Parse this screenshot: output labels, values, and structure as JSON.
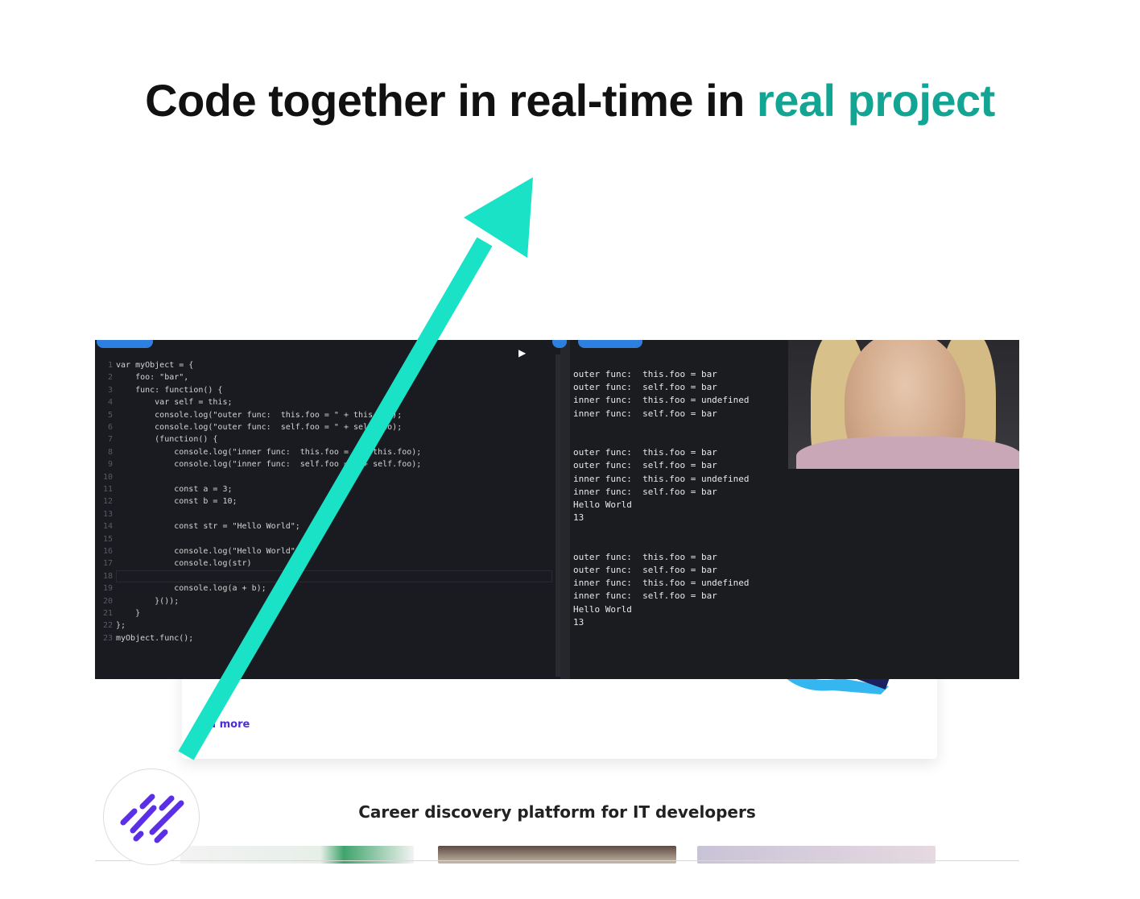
{
  "headline": {
    "text": "Code together in real-time in",
    "accent": "real project"
  },
  "colors": {
    "accent_text": "#12a593",
    "arrow": "#19e2c6",
    "logo": "#5b2ee8",
    "link": "#4a2fd6"
  },
  "editor": {
    "lines": [
      {
        "n": "1",
        "code": "var myObject = {"
      },
      {
        "n": "2",
        "code": "    foo: \"bar\","
      },
      {
        "n": "3",
        "code": "    func: function() {"
      },
      {
        "n": "4",
        "code": "        var self = this;"
      },
      {
        "n": "5",
        "code": "        console.log(\"outer func:  this.foo = \" + this.foo);"
      },
      {
        "n": "6",
        "code": "        console.log(\"outer func:  self.foo = \" + self.foo);"
      },
      {
        "n": "7",
        "code": "        (function() {"
      },
      {
        "n": "8",
        "code": "            console.log(\"inner func:  this.foo = \" + this.foo);"
      },
      {
        "n": "9",
        "code": "            console.log(\"inner func:  self.foo = \" + self.foo);"
      },
      {
        "n": "10",
        "code": ""
      },
      {
        "n": "11",
        "code": "            const a = 3;"
      },
      {
        "n": "12",
        "code": "            const b = 10;"
      },
      {
        "n": "13",
        "code": ""
      },
      {
        "n": "14",
        "code": "            const str = \"Hello World\";"
      },
      {
        "n": "15",
        "code": ""
      },
      {
        "n": "16",
        "code": "            console.log(\"Hello World\");"
      },
      {
        "n": "17",
        "code": "            console.log(str)"
      },
      {
        "n": "18",
        "code": ""
      },
      {
        "n": "19",
        "code": "            console.log(a + b);"
      },
      {
        "n": "20",
        "code": "        }());"
      },
      {
        "n": "21",
        "code": "    }"
      },
      {
        "n": "22",
        "code": "};"
      },
      {
        "n": "23",
        "code": "myObject.func();"
      }
    ]
  },
  "console": {
    "lines": [
      "outer func:  this.foo = bar",
      "outer func:  self.foo = bar",
      "inner func:  this.foo = undefined",
      "inner func:  self.foo = bar",
      "",
      "",
      "outer func:  this.foo = bar",
      "outer func:  self.foo = bar",
      "inner func:  this.foo = undefined",
      "inner func:  self.foo = bar",
      "Hello World",
      "13",
      "",
      "",
      "outer func:  this.foo = bar",
      "outer func:  self.foo = bar",
      "inner func:  this.foo = undefined",
      "inner func:  self.foo = bar",
      "Hello World",
      "13"
    ]
  },
  "background_page": {
    "read_more": "ad more",
    "tagline": "Career discovery platform for IT developers"
  }
}
